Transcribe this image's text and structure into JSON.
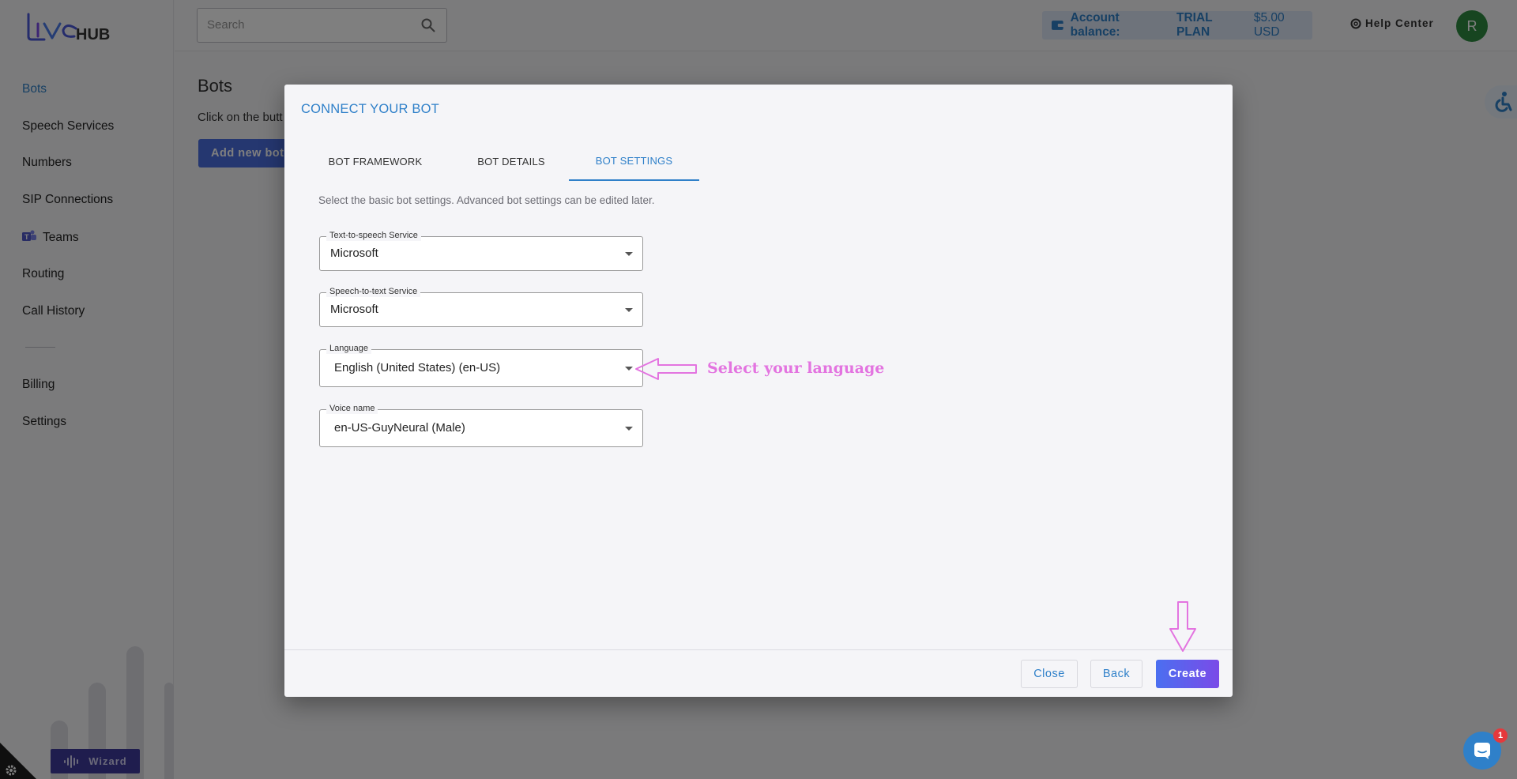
{
  "app": {
    "logo_text": "LiveHUB"
  },
  "sidebar": {
    "items": [
      {
        "label": "Bots",
        "active": true
      },
      {
        "label": "Speech Services"
      },
      {
        "label": "Numbers"
      },
      {
        "label": "SIP Connections"
      },
      {
        "label": "Teams",
        "icon": "teams-icon"
      },
      {
        "label": "Routing"
      },
      {
        "label": "Call History"
      },
      {
        "label": "Billing"
      },
      {
        "label": "Settings"
      }
    ],
    "wizard_label": "Wizard"
  },
  "topbar": {
    "search_placeholder": "Search",
    "balance_label": "Account balance:",
    "balance_plan": "TRIAL PLAN",
    "balance_amount": "$5.00 USD",
    "help_label": "Help Center",
    "avatar_initial": "R"
  },
  "page": {
    "title": "Bots",
    "hint": "Click on the butt",
    "add_button": "Add new bot"
  },
  "modal": {
    "title": "CONNECT YOUR BOT",
    "tabs": [
      {
        "label": "BOT FRAMEWORK"
      },
      {
        "label": "BOT DETAILS"
      },
      {
        "label": "BOT SETTINGS",
        "active": true
      }
    ],
    "description": "Select the basic bot settings. Advanced bot settings can be edited later.",
    "fields": {
      "tts": {
        "label": "Text-to-speech Service",
        "value": "Microsoft"
      },
      "stt": {
        "label": "Speech-to-text Service",
        "value": "Microsoft"
      },
      "language": {
        "label": "Language",
        "value": "English (United States) (en-US)"
      },
      "voice": {
        "label": "Voice name",
        "value": "en-US-GuyNeural (Male)"
      }
    },
    "annotation": "Select your language",
    "buttons": {
      "close": "Close",
      "back": "Back",
      "create": "Create"
    }
  },
  "chat": {
    "badge_count": "1"
  },
  "colors": {
    "accent": "#2f80c9",
    "annotation": "#e374e0",
    "avatar": "#2e8b40",
    "primary_gradient_start": "#4b6ff0",
    "primary_gradient_end": "#7a4be8"
  }
}
